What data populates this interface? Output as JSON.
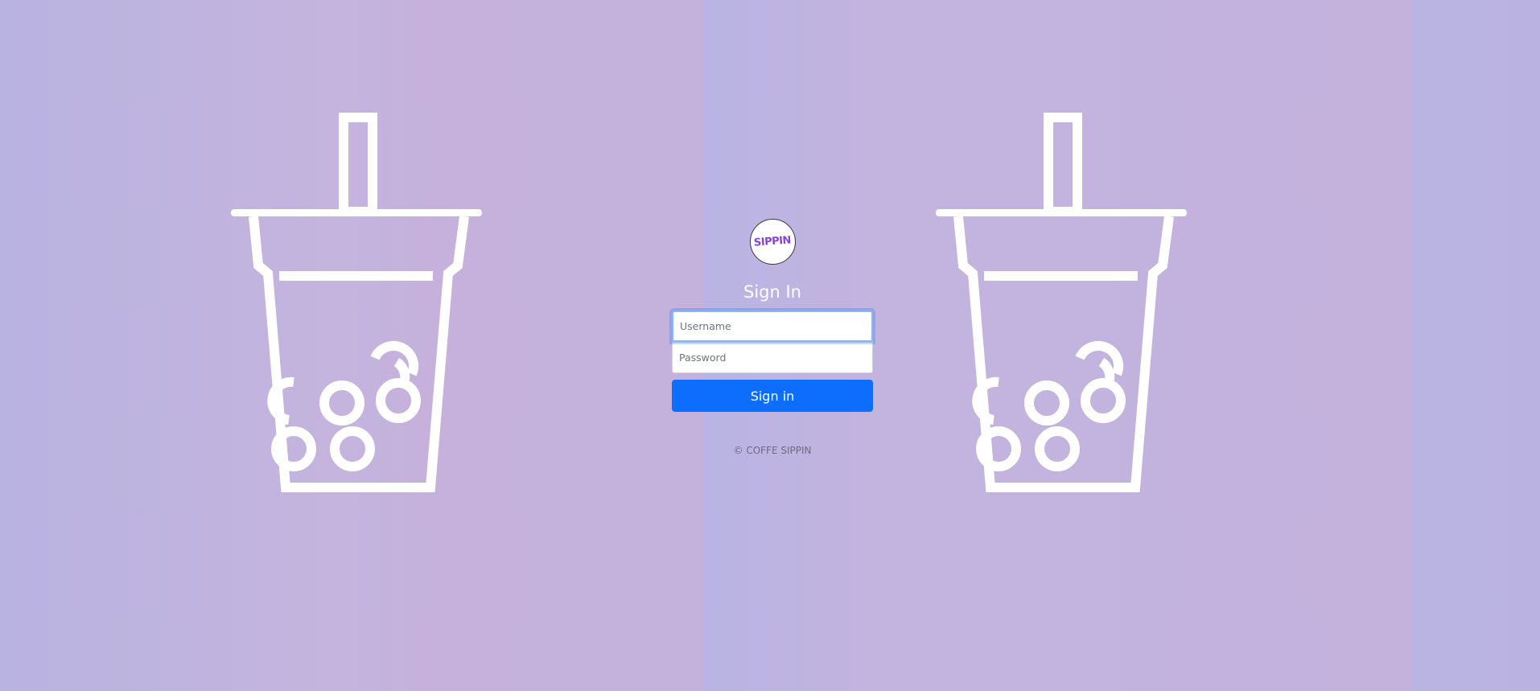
{
  "logo": {
    "text": "SIPPIN",
    "color": "#8a3fe0"
  },
  "signin": {
    "title": "Sign In",
    "username_placeholder": "Username",
    "password_placeholder": "Password",
    "button_label": "Sign in",
    "button_color": "#0d6efd"
  },
  "footer": {
    "copyright": "© COFFE SIPPIN"
  },
  "decorations": {
    "icon": "bubble-tea-cup-icon",
    "count": 2,
    "color": "#ffffff"
  }
}
